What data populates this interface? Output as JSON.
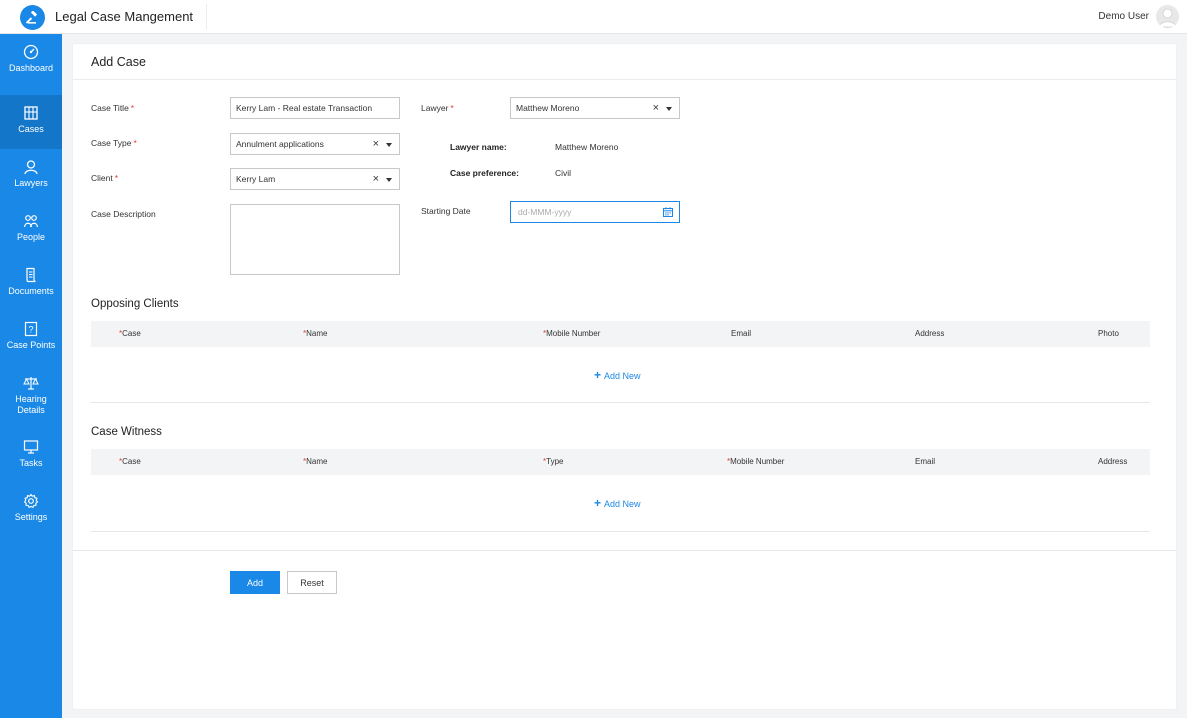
{
  "header": {
    "app_title": "Legal Case Mangement",
    "user_name": "Demo User"
  },
  "sidebar": {
    "items": [
      {
        "label": "Dashboard",
        "icon": "dashboard-icon"
      },
      {
        "label": "Cases",
        "icon": "cases-icon"
      },
      {
        "label": "Lawyers",
        "icon": "lawyers-icon"
      },
      {
        "label": "People",
        "icon": "people-icon"
      },
      {
        "label": "Documents",
        "icon": "documents-icon"
      },
      {
        "label": "Case Points",
        "icon": "case-points-icon"
      },
      {
        "label": "Hearing Details",
        "icon": "hearing-details-icon"
      },
      {
        "label": "Tasks",
        "icon": "tasks-icon"
      },
      {
        "label": "Settings",
        "icon": "settings-icon"
      }
    ],
    "active_item": "Cases"
  },
  "form": {
    "title": "Add Case",
    "case_title": {
      "label": "Case Title",
      "value": "Kerry Lam - Real estate Transaction"
    },
    "case_type": {
      "label": "Case Type",
      "value": "Annulment applications"
    },
    "client": {
      "label": "Client",
      "value": "Kerry Lam"
    },
    "case_description": {
      "label": "Case Description",
      "value": ""
    },
    "lawyer": {
      "label": "Lawyer",
      "value": "Matthew Moreno"
    },
    "lawyer_name": {
      "label": "Lawyer name:",
      "value": "Matthew Moreno"
    },
    "case_preference": {
      "label": "Case preference:",
      "value": "Civil"
    },
    "starting_date": {
      "label": "Starting Date",
      "placeholder": "dd-MMM-yyyy"
    }
  },
  "opposing_clients": {
    "title": "Opposing Clients",
    "columns": [
      {
        "label": "Case",
        "required": true
      },
      {
        "label": "Name",
        "required": true
      },
      {
        "label": "Mobile Number",
        "required": true
      },
      {
        "label": "Email",
        "required": false
      },
      {
        "label": "Address",
        "required": false
      },
      {
        "label": "Photo",
        "required": false
      }
    ],
    "add_new_label": "Add New"
  },
  "case_witness": {
    "title": "Case Witness",
    "columns": [
      {
        "label": "Case",
        "required": true
      },
      {
        "label": "Name",
        "required": true
      },
      {
        "label": "Type",
        "required": true
      },
      {
        "label": "Mobile Number",
        "required": true
      },
      {
        "label": "Email",
        "required": false
      },
      {
        "label": "Address",
        "required": false
      }
    ],
    "add_new_label": "Add New"
  },
  "actions": {
    "add_label": "Add",
    "reset_label": "Reset"
  },
  "colors": {
    "accent": "#1a88e6",
    "required": "#e53935"
  }
}
